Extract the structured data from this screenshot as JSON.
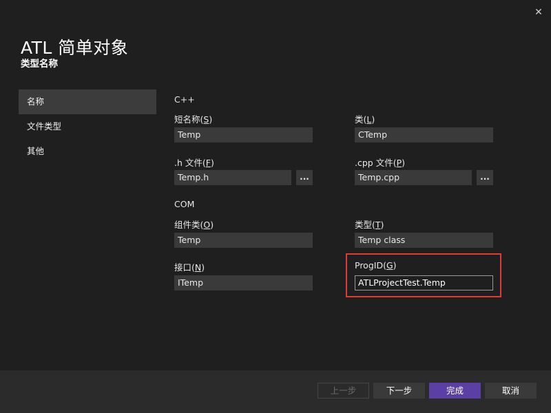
{
  "window": {
    "close_glyph": "✕"
  },
  "header": {
    "title": "ATL 简单对象",
    "subtitle": "类型名称"
  },
  "sidebar": {
    "items": [
      {
        "label": "名称"
      },
      {
        "label": "文件类型"
      },
      {
        "label": "其他"
      }
    ]
  },
  "cpp": {
    "section_label": "C++",
    "short_name": {
      "label": "短名称",
      "accel": "S",
      "value": "Temp"
    },
    "class": {
      "label": "类",
      "accel": "L",
      "value": "CTemp"
    },
    "h_file": {
      "label": ".h 文件",
      "accel": "F",
      "value": "Temp.h"
    },
    "cpp_file": {
      "label": ".cpp 文件",
      "accel": "P",
      "value": "Temp.cpp"
    },
    "browse_label": "..."
  },
  "com": {
    "section_label": "COM",
    "coclass": {
      "label": "组件类",
      "accel": "O",
      "value": "Temp"
    },
    "type": {
      "label": "类型",
      "accel": "T",
      "value": "Temp class"
    },
    "interface": {
      "label": "接口",
      "accel": "N",
      "value": "ITemp"
    },
    "progid": {
      "label": "ProgID",
      "accel": "G",
      "value": "ATLProjectTest.Temp"
    }
  },
  "footer": {
    "back": "上一步",
    "next": "下一步",
    "finish": "完成",
    "cancel": "取消"
  },
  "colors": {
    "background": "#1f1f1f",
    "footer": "#2b2b2b",
    "primary_button": "#5b3fa4",
    "highlight": "#e53935"
  }
}
